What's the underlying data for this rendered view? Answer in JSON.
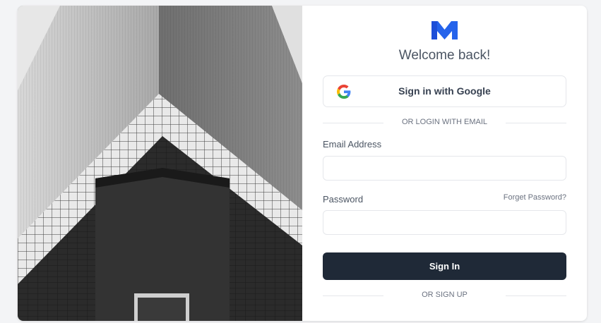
{
  "brand": {
    "logo_icon": "m-logo-icon",
    "accent": "#2563eb"
  },
  "heading": {
    "welcome": "Welcome back!"
  },
  "google": {
    "label": "Sign in with Google",
    "icon": "google-icon"
  },
  "dividers": {
    "email": "OR LOGIN WITH EMAIL",
    "signup": "OR SIGN UP"
  },
  "email": {
    "label": "Email Address",
    "value": "",
    "placeholder": ""
  },
  "password": {
    "label": "Password",
    "forgot": "Forget Password?",
    "value": "",
    "placeholder": ""
  },
  "signin": {
    "label": "Sign In"
  },
  "colors": {
    "button_bg": "#1f2937",
    "border": "#e5e7eb",
    "text": "#4b5563"
  }
}
